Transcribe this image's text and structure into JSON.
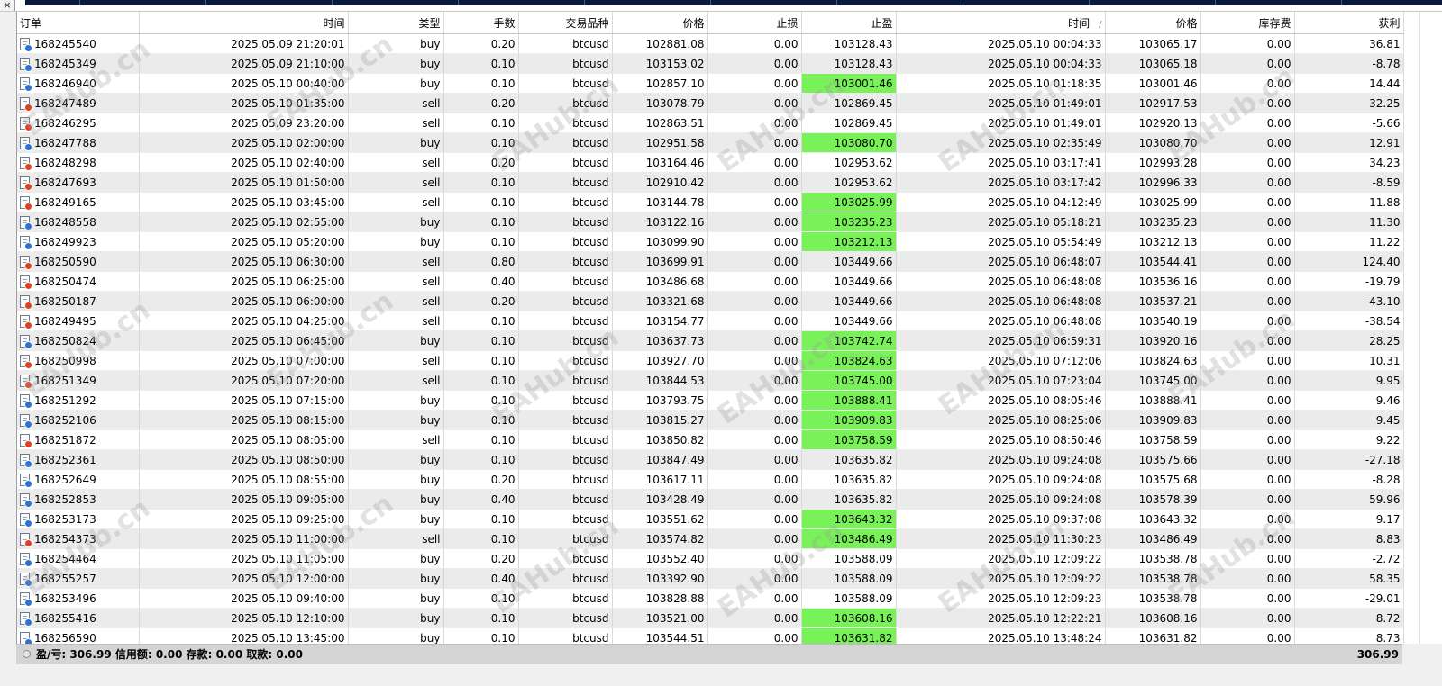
{
  "window": {
    "close_glyph": "×"
  },
  "columns": [
    {
      "key": "order",
      "label": "订单",
      "align": "l"
    },
    {
      "key": "open_time",
      "label": "时间",
      "align": "r"
    },
    {
      "key": "type",
      "label": "类型",
      "align": "r"
    },
    {
      "key": "volume",
      "label": "手数",
      "align": "r"
    },
    {
      "key": "symbol",
      "label": "交易品种",
      "align": "r"
    },
    {
      "key": "open_price",
      "label": "价格",
      "align": "r"
    },
    {
      "key": "sl",
      "label": "止损",
      "align": "r"
    },
    {
      "key": "tp",
      "label": "止盈",
      "align": "r"
    },
    {
      "key": "close_time",
      "label": "时间",
      "align": "r",
      "sort_glyph": "/"
    },
    {
      "key": "close_price",
      "label": "价格",
      "align": "r"
    },
    {
      "key": "swap",
      "label": "库存费",
      "align": "r"
    },
    {
      "key": "profit",
      "label": "获利",
      "align": "r"
    }
  ],
  "rows": [
    {
      "order": "168245540",
      "open_time": "2025.05.09 21:20:01",
      "type": "buy",
      "volume": "0.20",
      "symbol": "btcusd",
      "open_price": "102881.08",
      "sl": "0.00",
      "tp": "103128.43",
      "tp_hit": false,
      "close_time": "2025.05.10 00:04:33",
      "close_price": "103065.17",
      "swap": "0.00",
      "profit": "36.81"
    },
    {
      "order": "168245349",
      "open_time": "2025.05.09 21:10:00",
      "type": "buy",
      "volume": "0.10",
      "symbol": "btcusd",
      "open_price": "103153.02",
      "sl": "0.00",
      "tp": "103128.43",
      "tp_hit": false,
      "close_time": "2025.05.10 00:04:33",
      "close_price": "103065.18",
      "swap": "0.00",
      "profit": "-8.78"
    },
    {
      "order": "168246940",
      "open_time": "2025.05.10 00:40:00",
      "type": "buy",
      "volume": "0.10",
      "symbol": "btcusd",
      "open_price": "102857.10",
      "sl": "0.00",
      "tp": "103001.46",
      "tp_hit": true,
      "close_time": "2025.05.10 01:18:35",
      "close_price": "103001.46",
      "swap": "0.00",
      "profit": "14.44"
    },
    {
      "order": "168247489",
      "open_time": "2025.05.10 01:35:00",
      "type": "sell",
      "volume": "0.20",
      "symbol": "btcusd",
      "open_price": "103078.79",
      "sl": "0.00",
      "tp": "102869.45",
      "tp_hit": false,
      "close_time": "2025.05.10 01:49:01",
      "close_price": "102917.53",
      "swap": "0.00",
      "profit": "32.25"
    },
    {
      "order": "168246295",
      "open_time": "2025.05.09 23:20:00",
      "type": "sell",
      "volume": "0.10",
      "symbol": "btcusd",
      "open_price": "102863.51",
      "sl": "0.00",
      "tp": "102869.45",
      "tp_hit": false,
      "close_time": "2025.05.10 01:49:01",
      "close_price": "102920.13",
      "swap": "0.00",
      "profit": "-5.66"
    },
    {
      "order": "168247788",
      "open_time": "2025.05.10 02:00:00",
      "type": "buy",
      "volume": "0.10",
      "symbol": "btcusd",
      "open_price": "102951.58",
      "sl": "0.00",
      "tp": "103080.70",
      "tp_hit": true,
      "close_time": "2025.05.10 02:35:49",
      "close_price": "103080.70",
      "swap": "0.00",
      "profit": "12.91"
    },
    {
      "order": "168248298",
      "open_time": "2025.05.10 02:40:00",
      "type": "sell",
      "volume": "0.20",
      "symbol": "btcusd",
      "open_price": "103164.46",
      "sl": "0.00",
      "tp": "102953.62",
      "tp_hit": false,
      "close_time": "2025.05.10 03:17:41",
      "close_price": "102993.28",
      "swap": "0.00",
      "profit": "34.23"
    },
    {
      "order": "168247693",
      "open_time": "2025.05.10 01:50:00",
      "type": "sell",
      "volume": "0.10",
      "symbol": "btcusd",
      "open_price": "102910.42",
      "sl": "0.00",
      "tp": "102953.62",
      "tp_hit": false,
      "close_time": "2025.05.10 03:17:42",
      "close_price": "102996.33",
      "swap": "0.00",
      "profit": "-8.59"
    },
    {
      "order": "168249165",
      "open_time": "2025.05.10 03:45:00",
      "type": "sell",
      "volume": "0.10",
      "symbol": "btcusd",
      "open_price": "103144.78",
      "sl": "0.00",
      "tp": "103025.99",
      "tp_hit": true,
      "close_time": "2025.05.10 04:12:49",
      "close_price": "103025.99",
      "swap": "0.00",
      "profit": "11.88"
    },
    {
      "order": "168248558",
      "open_time": "2025.05.10 02:55:00",
      "type": "buy",
      "volume": "0.10",
      "symbol": "btcusd",
      "open_price": "103122.16",
      "sl": "0.00",
      "tp": "103235.23",
      "tp_hit": true,
      "close_time": "2025.05.10 05:18:21",
      "close_price": "103235.23",
      "swap": "0.00",
      "profit": "11.30"
    },
    {
      "order": "168249923",
      "open_time": "2025.05.10 05:20:00",
      "type": "buy",
      "volume": "0.10",
      "symbol": "btcusd",
      "open_price": "103099.90",
      "sl": "0.00",
      "tp": "103212.13",
      "tp_hit": true,
      "close_time": "2025.05.10 05:54:49",
      "close_price": "103212.13",
      "swap": "0.00",
      "profit": "11.22"
    },
    {
      "order": "168250590",
      "open_time": "2025.05.10 06:30:00",
      "type": "sell",
      "volume": "0.80",
      "symbol": "btcusd",
      "open_price": "103699.91",
      "sl": "0.00",
      "tp": "103449.66",
      "tp_hit": false,
      "close_time": "2025.05.10 06:48:07",
      "close_price": "103544.41",
      "swap": "0.00",
      "profit": "124.40"
    },
    {
      "order": "168250474",
      "open_time": "2025.05.10 06:25:00",
      "type": "sell",
      "volume": "0.40",
      "symbol": "btcusd",
      "open_price": "103486.68",
      "sl": "0.00",
      "tp": "103449.66",
      "tp_hit": false,
      "close_time": "2025.05.10 06:48:08",
      "close_price": "103536.16",
      "swap": "0.00",
      "profit": "-19.79"
    },
    {
      "order": "168250187",
      "open_time": "2025.05.10 06:00:00",
      "type": "sell",
      "volume": "0.20",
      "symbol": "btcusd",
      "open_price": "103321.68",
      "sl": "0.00",
      "tp": "103449.66",
      "tp_hit": false,
      "close_time": "2025.05.10 06:48:08",
      "close_price": "103537.21",
      "swap": "0.00",
      "profit": "-43.10"
    },
    {
      "order": "168249495",
      "open_time": "2025.05.10 04:25:00",
      "type": "sell",
      "volume": "0.10",
      "symbol": "btcusd",
      "open_price": "103154.77",
      "sl": "0.00",
      "tp": "103449.66",
      "tp_hit": false,
      "close_time": "2025.05.10 06:48:08",
      "close_price": "103540.19",
      "swap": "0.00",
      "profit": "-38.54"
    },
    {
      "order": "168250824",
      "open_time": "2025.05.10 06:45:00",
      "type": "buy",
      "volume": "0.10",
      "symbol": "btcusd",
      "open_price": "103637.73",
      "sl": "0.00",
      "tp": "103742.74",
      "tp_hit": true,
      "close_time": "2025.05.10 06:59:31",
      "close_price": "103920.16",
      "swap": "0.00",
      "profit": "28.25"
    },
    {
      "order": "168250998",
      "open_time": "2025.05.10 07:00:00",
      "type": "sell",
      "volume": "0.10",
      "symbol": "btcusd",
      "open_price": "103927.70",
      "sl": "0.00",
      "tp": "103824.63",
      "tp_hit": true,
      "close_time": "2025.05.10 07:12:06",
      "close_price": "103824.63",
      "swap": "0.00",
      "profit": "10.31"
    },
    {
      "order": "168251349",
      "open_time": "2025.05.10 07:20:00",
      "type": "sell",
      "volume": "0.10",
      "symbol": "btcusd",
      "open_price": "103844.53",
      "sl": "0.00",
      "tp": "103745.00",
      "tp_hit": true,
      "close_time": "2025.05.10 07:23:04",
      "close_price": "103745.00",
      "swap": "0.00",
      "profit": "9.95"
    },
    {
      "order": "168251292",
      "open_time": "2025.05.10 07:15:00",
      "type": "buy",
      "volume": "0.10",
      "symbol": "btcusd",
      "open_price": "103793.75",
      "sl": "0.00",
      "tp": "103888.41",
      "tp_hit": true,
      "close_time": "2025.05.10 08:05:46",
      "close_price": "103888.41",
      "swap": "0.00",
      "profit": "9.46"
    },
    {
      "order": "168252106",
      "open_time": "2025.05.10 08:15:00",
      "type": "buy",
      "volume": "0.10",
      "symbol": "btcusd",
      "open_price": "103815.27",
      "sl": "0.00",
      "tp": "103909.83",
      "tp_hit": true,
      "close_time": "2025.05.10 08:25:06",
      "close_price": "103909.83",
      "swap": "0.00",
      "profit": "9.45"
    },
    {
      "order": "168251872",
      "open_time": "2025.05.10 08:05:00",
      "type": "sell",
      "volume": "0.10",
      "symbol": "btcusd",
      "open_price": "103850.82",
      "sl": "0.00",
      "tp": "103758.59",
      "tp_hit": true,
      "close_time": "2025.05.10 08:50:46",
      "close_price": "103758.59",
      "swap": "0.00",
      "profit": "9.22"
    },
    {
      "order": "168252361",
      "open_time": "2025.05.10 08:50:00",
      "type": "buy",
      "volume": "0.10",
      "symbol": "btcusd",
      "open_price": "103847.49",
      "sl": "0.00",
      "tp": "103635.82",
      "tp_hit": false,
      "close_time": "2025.05.10 09:24:08",
      "close_price": "103575.66",
      "swap": "0.00",
      "profit": "-27.18"
    },
    {
      "order": "168252649",
      "open_time": "2025.05.10 08:55:00",
      "type": "buy",
      "volume": "0.20",
      "symbol": "btcusd",
      "open_price": "103617.11",
      "sl": "0.00",
      "tp": "103635.82",
      "tp_hit": false,
      "close_time": "2025.05.10 09:24:08",
      "close_price": "103575.68",
      "swap": "0.00",
      "profit": "-8.28"
    },
    {
      "order": "168252853",
      "open_time": "2025.05.10 09:05:00",
      "type": "buy",
      "volume": "0.40",
      "symbol": "btcusd",
      "open_price": "103428.49",
      "sl": "0.00",
      "tp": "103635.82",
      "tp_hit": false,
      "close_time": "2025.05.10 09:24:08",
      "close_price": "103578.39",
      "swap": "0.00",
      "profit": "59.96"
    },
    {
      "order": "168253173",
      "open_time": "2025.05.10 09:25:00",
      "type": "buy",
      "volume": "0.10",
      "symbol": "btcusd",
      "open_price": "103551.62",
      "sl": "0.00",
      "tp": "103643.32",
      "tp_hit": true,
      "close_time": "2025.05.10 09:37:08",
      "close_price": "103643.32",
      "swap": "0.00",
      "profit": "9.17"
    },
    {
      "order": "168254373",
      "open_time": "2025.05.10 11:00:00",
      "type": "sell",
      "volume": "0.10",
      "symbol": "btcusd",
      "open_price": "103574.82",
      "sl": "0.00",
      "tp": "103486.49",
      "tp_hit": true,
      "close_time": "2025.05.10 11:30:23",
      "close_price": "103486.49",
      "swap": "0.00",
      "profit": "8.83"
    },
    {
      "order": "168254464",
      "open_time": "2025.05.10 11:05:00",
      "type": "buy",
      "volume": "0.20",
      "symbol": "btcusd",
      "open_price": "103552.40",
      "sl": "0.00",
      "tp": "103588.09",
      "tp_hit": false,
      "close_time": "2025.05.10 12:09:22",
      "close_price": "103538.78",
      "swap": "0.00",
      "profit": "-2.72"
    },
    {
      "order": "168255257",
      "open_time": "2025.05.10 12:00:00",
      "type": "buy",
      "volume": "0.40",
      "symbol": "btcusd",
      "open_price": "103392.90",
      "sl": "0.00",
      "tp": "103588.09",
      "tp_hit": false,
      "close_time": "2025.05.10 12:09:22",
      "close_price": "103538.78",
      "swap": "0.00",
      "profit": "58.35"
    },
    {
      "order": "168253496",
      "open_time": "2025.05.10 09:40:00",
      "type": "buy",
      "volume": "0.10",
      "symbol": "btcusd",
      "open_price": "103828.88",
      "sl": "0.00",
      "tp": "103588.09",
      "tp_hit": false,
      "close_time": "2025.05.10 12:09:23",
      "close_price": "103538.78",
      "swap": "0.00",
      "profit": "-29.01"
    },
    {
      "order": "168255416",
      "open_time": "2025.05.10 12:10:00",
      "type": "buy",
      "volume": "0.10",
      "symbol": "btcusd",
      "open_price": "103521.00",
      "sl": "0.00",
      "tp": "103608.16",
      "tp_hit": true,
      "close_time": "2025.05.10 12:22:21",
      "close_price": "103608.16",
      "swap": "0.00",
      "profit": "8.72"
    },
    {
      "order": "168256590",
      "open_time": "2025.05.10 13:45:00",
      "type": "buy",
      "volume": "0.10",
      "symbol": "btcusd",
      "open_price": "103544.51",
      "sl": "0.00",
      "tp": "103631.82",
      "tp_hit": true,
      "close_time": "2025.05.10 13:48:24",
      "close_price": "103631.82",
      "swap": "0.00",
      "profit": "8.73"
    }
  ],
  "summary": {
    "text": "盈/亏: 306.99  信用额: 0.00  存款: 0.00  取款: 0.00",
    "total": "306.99"
  },
  "watermark": {
    "text": "EAHub.cn"
  },
  "colors": {
    "tp_hit": "#79f25a",
    "buy_icon": "#2a73d6",
    "sell_icon": "#e2401c",
    "row_alt": "#ebebeb",
    "summary_bg": "#d4d4d4"
  },
  "icons": {
    "order_row": "ticket-document-icon",
    "summary": "summary-circle-icon",
    "close": "close-icon"
  }
}
